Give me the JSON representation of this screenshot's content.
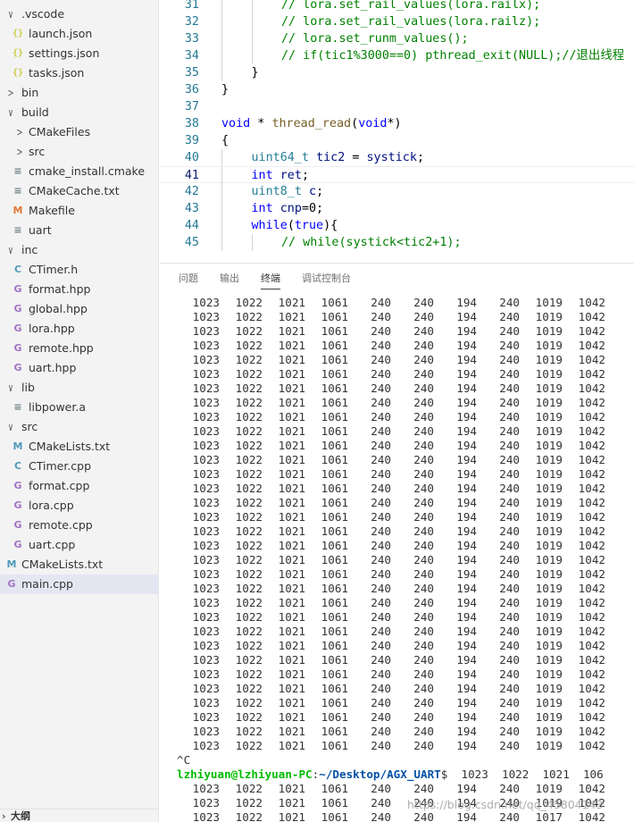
{
  "explorer": {
    "items": [
      {
        "label": ".vscode",
        "kind": "folder",
        "open": true,
        "depth": 0
      },
      {
        "label": "launch.json",
        "kind": "json",
        "depth": 1
      },
      {
        "label": "settings.json",
        "kind": "json",
        "depth": 1
      },
      {
        "label": "tasks.json",
        "kind": "json",
        "depth": 1
      },
      {
        "label": "bin",
        "kind": "folder",
        "open": false,
        "depth": 0
      },
      {
        "label": "build",
        "kind": "folder",
        "open": true,
        "depth": 0
      },
      {
        "label": "CMakeFiles",
        "kind": "folder",
        "open": false,
        "depth": 1
      },
      {
        "label": "src",
        "kind": "folder",
        "open": false,
        "depth": 1
      },
      {
        "label": "cmake_install.cmake",
        "kind": "lines",
        "depth": 1
      },
      {
        "label": "CMakeCache.txt",
        "kind": "lines",
        "depth": 1
      },
      {
        "label": "Makefile",
        "kind": "make",
        "depth": 1
      },
      {
        "label": "uart",
        "kind": "lines",
        "depth": 1
      },
      {
        "label": "inc",
        "kind": "folder",
        "open": true,
        "depth": 0
      },
      {
        "label": "CTimer.h",
        "kind": "c",
        "depth": 1
      },
      {
        "label": "format.hpp",
        "kind": "cpp",
        "depth": 1
      },
      {
        "label": "global.hpp",
        "kind": "cpp",
        "depth": 1
      },
      {
        "label": "lora.hpp",
        "kind": "cpp",
        "depth": 1
      },
      {
        "label": "remote.hpp",
        "kind": "cpp",
        "depth": 1
      },
      {
        "label": "uart.hpp",
        "kind": "cpp",
        "depth": 1
      },
      {
        "label": "lib",
        "kind": "folder",
        "open": true,
        "depth": 0
      },
      {
        "label": "libpower.a",
        "kind": "lines",
        "depth": 1
      },
      {
        "label": "src",
        "kind": "folder",
        "open": true,
        "depth": 0
      },
      {
        "label": "CMakeLists.txt",
        "kind": "cmake",
        "depth": 1
      },
      {
        "label": "CTimer.cpp",
        "kind": "c",
        "depth": 1
      },
      {
        "label": "format.cpp",
        "kind": "cpp",
        "depth": 1
      },
      {
        "label": "lora.cpp",
        "kind": "cpp",
        "depth": 1
      },
      {
        "label": "remote.cpp",
        "kind": "cpp",
        "depth": 1
      },
      {
        "label": "uart.cpp",
        "kind": "cpp",
        "depth": 1
      },
      {
        "label": "CMakeLists.txt",
        "kind": "cmake",
        "depth": 0
      },
      {
        "label": "main.cpp",
        "kind": "cpp",
        "depth": 0,
        "selected": true
      }
    ],
    "outline_label": "大纲"
  },
  "editor": {
    "current_line": 41,
    "lines": [
      {
        "n": "31",
        "indent": 2,
        "tokens": [
          [
            "com",
            "// lora.set_rail_values(lora.railx);"
          ]
        ]
      },
      {
        "n": "32",
        "indent": 2,
        "tokens": [
          [
            "com",
            "// lora.set_rail_values(lora.railz);"
          ]
        ]
      },
      {
        "n": "33",
        "indent": 2,
        "tokens": [
          [
            "com",
            "// lora.set_runm_values();"
          ]
        ]
      },
      {
        "n": "34",
        "indent": 2,
        "tokens": [
          [
            "com",
            "// if(tic1%3000==0) pthread_exit(NULL);//退出线程"
          ]
        ]
      },
      {
        "n": "35",
        "indent": 1,
        "tokens": [
          [
            "pun",
            "}"
          ]
        ]
      },
      {
        "n": "36",
        "indent": 0,
        "tokens": [
          [
            "pun",
            "}"
          ]
        ]
      },
      {
        "n": "37",
        "indent": 0,
        "tokens": []
      },
      {
        "n": "38",
        "indent": 0,
        "tokens": [
          [
            "kw",
            "void"
          ],
          [
            "pun",
            " * "
          ],
          [
            "fn",
            "thread_read"
          ],
          [
            "pun",
            "("
          ],
          [
            "kw",
            "void"
          ],
          [
            "pun",
            "*)"
          ]
        ]
      },
      {
        "n": "39",
        "indent": 0,
        "tokens": [
          [
            "pun",
            "{"
          ]
        ]
      },
      {
        "n": "40",
        "indent": 1,
        "tokens": [
          [
            "ty",
            "uint64_t"
          ],
          [
            "pun",
            " "
          ],
          [
            "var",
            "tic2"
          ],
          [
            "pun",
            " = "
          ],
          [
            "var",
            "systick"
          ],
          [
            "pun",
            ";"
          ]
        ]
      },
      {
        "n": "41",
        "indent": 1,
        "tokens": [
          [
            "kw",
            "int"
          ],
          [
            "pun",
            " "
          ],
          [
            "var",
            "ret"
          ],
          [
            "pun",
            ";"
          ]
        ]
      },
      {
        "n": "42",
        "indent": 1,
        "tokens": [
          [
            "ty",
            "uint8_t"
          ],
          [
            "pun",
            " "
          ],
          [
            "var",
            "c"
          ],
          [
            "pun",
            ";"
          ]
        ]
      },
      {
        "n": "43",
        "indent": 1,
        "tokens": [
          [
            "kw",
            "int"
          ],
          [
            "pun",
            " "
          ],
          [
            "var",
            "cnp"
          ],
          [
            "pun",
            "=0;"
          ]
        ]
      },
      {
        "n": "44",
        "indent": 1,
        "tokens": [
          [
            "kw",
            "while"
          ],
          [
            "pun",
            "("
          ],
          [
            "kw",
            "true"
          ],
          [
            "pun",
            "){"
          ]
        ]
      },
      {
        "n": "45",
        "indent": 2,
        "tokens": [
          [
            "com",
            "// while(systick<tic2+1);"
          ]
        ]
      }
    ]
  },
  "panel": {
    "tabs": [
      "问题",
      "输出",
      "终端",
      "调试控制台"
    ],
    "active_tab": "终端"
  },
  "terminal": {
    "rows_before": [
      [
        "1023",
        "1022",
        "1021",
        "1061",
        "240",
        "240",
        "194",
        "240",
        "1019",
        "1042"
      ],
      [
        "1023",
        "1022",
        "1021",
        "1061",
        "240",
        "240",
        "194",
        "240",
        "1019",
        "1042"
      ],
      [
        "1023",
        "1022",
        "1021",
        "1061",
        "240",
        "240",
        "194",
        "240",
        "1019",
        "1042"
      ],
      [
        "1023",
        "1022",
        "1021",
        "1061",
        "240",
        "240",
        "194",
        "240",
        "1019",
        "1042"
      ],
      [
        "1023",
        "1022",
        "1021",
        "1061",
        "240",
        "240",
        "194",
        "240",
        "1019",
        "1042"
      ],
      [
        "1023",
        "1022",
        "1021",
        "1061",
        "240",
        "240",
        "194",
        "240",
        "1019",
        "1042"
      ],
      [
        "1023",
        "1022",
        "1021",
        "1061",
        "240",
        "240",
        "194",
        "240",
        "1019",
        "1042"
      ],
      [
        "1023",
        "1022",
        "1021",
        "1061",
        "240",
        "240",
        "194",
        "240",
        "1019",
        "1042"
      ],
      [
        "1023",
        "1022",
        "1021",
        "1061",
        "240",
        "240",
        "194",
        "240",
        "1019",
        "1042"
      ],
      [
        "1023",
        "1022",
        "1021",
        "1061",
        "240",
        "240",
        "194",
        "240",
        "1019",
        "1042"
      ],
      [
        "1023",
        "1022",
        "1021",
        "1061",
        "240",
        "240",
        "194",
        "240",
        "1019",
        "1042"
      ],
      [
        "1023",
        "1022",
        "1021",
        "1061",
        "240",
        "240",
        "194",
        "240",
        "1019",
        "1042"
      ],
      [
        "1023",
        "1022",
        "1021",
        "1061",
        "240",
        "240",
        "194",
        "240",
        "1019",
        "1042"
      ],
      [
        "1023",
        "1022",
        "1021",
        "1061",
        "240",
        "240",
        "194",
        "240",
        "1019",
        "1042"
      ],
      [
        "1023",
        "1022",
        "1021",
        "1061",
        "240",
        "240",
        "194",
        "240",
        "1019",
        "1042"
      ],
      [
        "1023",
        "1022",
        "1021",
        "1061",
        "240",
        "240",
        "194",
        "240",
        "1019",
        "1042"
      ],
      [
        "1023",
        "1022",
        "1021",
        "1061",
        "240",
        "240",
        "194",
        "240",
        "1019",
        "1042"
      ],
      [
        "1023",
        "1022",
        "1021",
        "1061",
        "240",
        "240",
        "194",
        "240",
        "1019",
        "1042"
      ],
      [
        "1023",
        "1022",
        "1021",
        "1061",
        "240",
        "240",
        "194",
        "240",
        "1019",
        "1042"
      ],
      [
        "1023",
        "1022",
        "1021",
        "1061",
        "240",
        "240",
        "194",
        "240",
        "1019",
        "1042"
      ],
      [
        "1023",
        "1022",
        "1021",
        "1061",
        "240",
        "240",
        "194",
        "240",
        "1019",
        "1042"
      ],
      [
        "1023",
        "1022",
        "1021",
        "1061",
        "240",
        "240",
        "194",
        "240",
        "1019",
        "1042"
      ],
      [
        "1023",
        "1022",
        "1021",
        "1061",
        "240",
        "240",
        "194",
        "240",
        "1019",
        "1042"
      ],
      [
        "1023",
        "1022",
        "1021",
        "1061",
        "240",
        "240",
        "194",
        "240",
        "1019",
        "1042"
      ],
      [
        "1023",
        "1022",
        "1021",
        "1061",
        "240",
        "240",
        "194",
        "240",
        "1019",
        "1042"
      ],
      [
        "1023",
        "1022",
        "1021",
        "1061",
        "240",
        "240",
        "194",
        "240",
        "1019",
        "1042"
      ],
      [
        "1023",
        "1022",
        "1021",
        "1061",
        "240",
        "240",
        "194",
        "240",
        "1019",
        "1042"
      ],
      [
        "1023",
        "1022",
        "1021",
        "1061",
        "240",
        "240",
        "194",
        "240",
        "1019",
        "1042"
      ],
      [
        "1023",
        "1022",
        "1021",
        "1061",
        "240",
        "240",
        "194",
        "240",
        "1019",
        "1042"
      ],
      [
        "1023",
        "1022",
        "1021",
        "1061",
        "240",
        "240",
        "194",
        "240",
        "1019",
        "1042"
      ],
      [
        "1023",
        "1022",
        "1021",
        "1061",
        "240",
        "240",
        "194",
        "240",
        "1019",
        "1042"
      ],
      [
        "1023",
        "1022",
        "1021",
        "1061",
        "240",
        "240",
        "194",
        "240",
        "1019",
        "1042"
      ]
    ],
    "interrupt": "^C",
    "prompt_user": "lzhiyuan@lzhiyuan-PC",
    "prompt_sep": ":",
    "prompt_path": "~/Desktop/AGX_UART",
    "prompt_end": "$",
    "prompt_trailing": "  1023  1022  1021  106",
    "rows_after": [
      [
        "1023",
        "1022",
        "1021",
        "1061",
        "240",
        "240",
        "194",
        "240",
        "1019",
        "1042"
      ],
      [
        "1023",
        "1022",
        "1021",
        "1061",
        "240",
        "240",
        "194",
        "240",
        "1019",
        "1042"
      ],
      [
        "1023",
        "1022",
        "1021",
        "1061",
        "240",
        "240",
        "194",
        "240",
        "1017",
        "1042"
      ]
    ]
  },
  "watermark": "https://blog.csdn.net/qq_45804143"
}
